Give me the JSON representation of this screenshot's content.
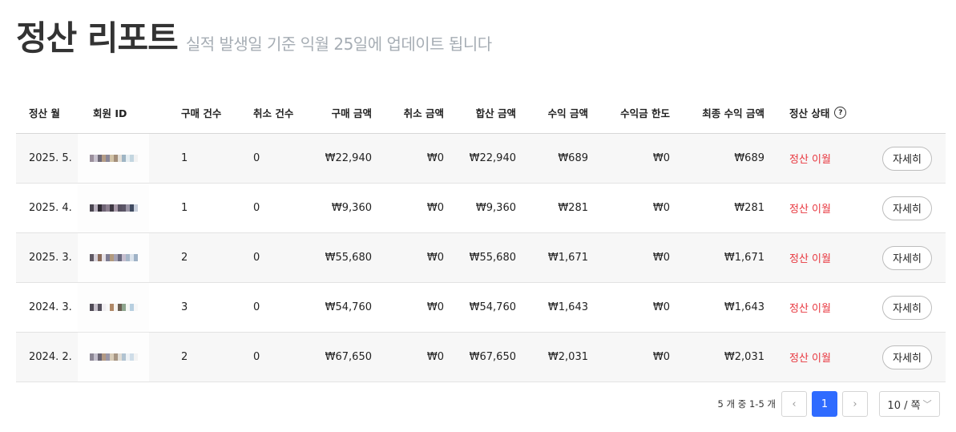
{
  "header": {
    "title": "정산 리포트",
    "subtitle": "실적 발생일 기준 익월 25일에 업데이트 됩니다"
  },
  "table": {
    "columns": {
      "month": "정산 월",
      "member_id": "회원 ID",
      "purchase_count": "구매 건수",
      "cancel_count": "취소 건수",
      "purchase_amount": "구매 금액",
      "cancel_amount": "취소 금액",
      "total_amount": "합산 금액",
      "profit_amount": "수익 금액",
      "profit_limit": "수익금 한도",
      "final_profit": "최종 수익 금액",
      "status": "정산 상태"
    },
    "rows": [
      {
        "month": "2025. 5.",
        "purchase_count": "1",
        "cancel_count": "0",
        "purchase_amount": "₩22,940",
        "cancel_amount": "₩0",
        "total_amount": "₩22,940",
        "profit_amount": "₩689",
        "profit_limit": "₩0",
        "final_profit": "₩689",
        "status": "정산 이월",
        "action": "자세히"
      },
      {
        "month": "2025. 4.",
        "purchase_count": "1",
        "cancel_count": "0",
        "purchase_amount": "₩9,360",
        "cancel_amount": "₩0",
        "total_amount": "₩9,360",
        "profit_amount": "₩281",
        "profit_limit": "₩0",
        "final_profit": "₩281",
        "status": "정산 이월",
        "action": "자세히"
      },
      {
        "month": "2025. 3.",
        "purchase_count": "2",
        "cancel_count": "0",
        "purchase_amount": "₩55,680",
        "cancel_amount": "₩0",
        "total_amount": "₩55,680",
        "profit_amount": "₩1,671",
        "profit_limit": "₩0",
        "final_profit": "₩1,671",
        "status": "정산 이월",
        "action": "자세히"
      },
      {
        "month": "2024. 3.",
        "purchase_count": "3",
        "cancel_count": "0",
        "purchase_amount": "₩54,760",
        "cancel_amount": "₩0",
        "total_amount": "₩54,760",
        "profit_amount": "₩1,643",
        "profit_limit": "₩0",
        "final_profit": "₩1,643",
        "status": "정산 이월",
        "action": "자세히"
      },
      {
        "month": "2024. 2.",
        "purchase_count": "2",
        "cancel_count": "0",
        "purchase_amount": "₩67,650",
        "cancel_amount": "₩0",
        "total_amount": "₩67,650",
        "profit_amount": "₩2,031",
        "profit_limit": "₩0",
        "final_profit": "₩2,031",
        "status": "정산 이월",
        "action": "자세히"
      }
    ]
  },
  "pagination": {
    "count_text": "5 개 중 1-5 개",
    "current_page": "1",
    "per_page": "10 / 쪽"
  },
  "colors": {
    "status": "#e8373f",
    "accent": "#2f6bff"
  }
}
